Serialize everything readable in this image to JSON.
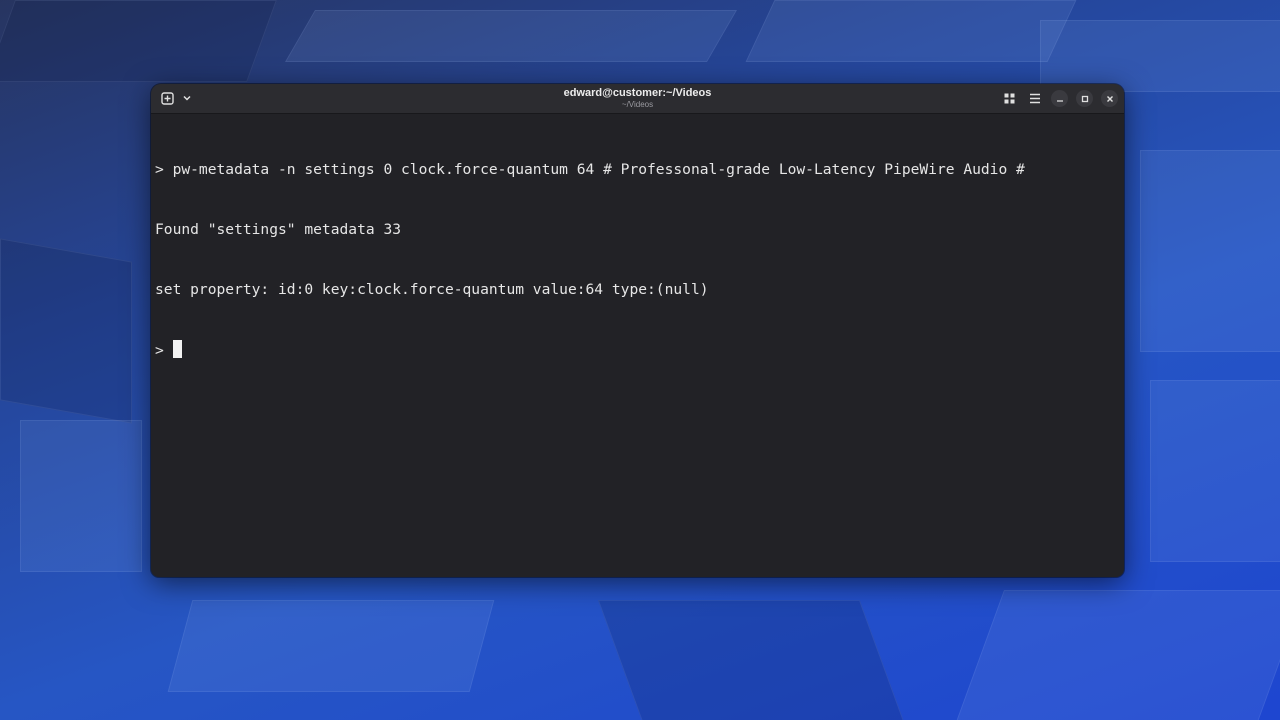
{
  "window": {
    "title": "edward@customer:~/Videos",
    "subtitle": "~/Videos"
  },
  "titlebar": {
    "new_tab_icon": "new-tab-icon",
    "tab_menu_icon": "chevron-down-icon",
    "view_tabs_icon": "grid-icon",
    "menu_icon": "hamburger-menu-icon",
    "minimize_icon": "minimize-icon",
    "maximize_icon": "maximize-icon",
    "close_icon": "close-icon"
  },
  "terminal": {
    "lines": [
      "> pw-metadata -n settings 0 clock.force-quantum 64 # Professonal-grade Low-Latency PipeWire Audio #",
      "Found \"settings\" metadata 33",
      "set property: id:0 key:clock.force-quantum value:64 type:(null)"
    ],
    "prompt": "> "
  },
  "colors": {
    "terminal_bg": "#222226",
    "titlebar_bg": "#2c2c30",
    "text": "#e6e6e6"
  }
}
